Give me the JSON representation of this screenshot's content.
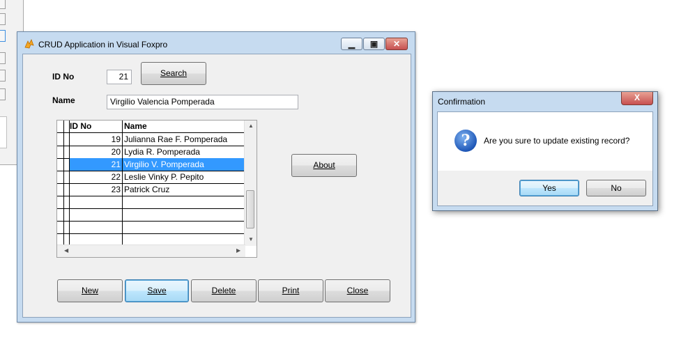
{
  "main_window": {
    "title": "CRUD Application in Visual Foxpro",
    "controls": {
      "minimize": "▁",
      "restore": "▣",
      "close": "✕"
    }
  },
  "form": {
    "id_label": "ID No",
    "id_value": "21",
    "search_button": "Search",
    "name_label": "Name",
    "name_value": "Virgilio Valencia Pomperada",
    "about_button": "About"
  },
  "grid": {
    "columns": [
      "ID No",
      "Name"
    ],
    "rows": [
      {
        "id": "19",
        "name": "Julianna Rae F. Pomperada"
      },
      {
        "id": "20",
        "name": "Lydia R. Pomperada"
      },
      {
        "id": "21",
        "name": "Virgilio V. Pomperada"
      },
      {
        "id": "22",
        "name": "Leslie Vinky P. Pepito"
      },
      {
        "id": "23",
        "name": "Patrick Cruz"
      }
    ],
    "selected_id": "21"
  },
  "toolbar": {
    "new_label": "New",
    "save_label": "Save",
    "delete_label": "Delete",
    "print_label": "Print",
    "close_label": "Close"
  },
  "dialog": {
    "title": "Confirmation",
    "close_glyph": "X",
    "message": "Are you sure to update existing record?",
    "yes_label": "Yes",
    "no_label": "No",
    "icon": "question-icon"
  },
  "colors": {
    "selection": "#3399ff",
    "window_frame": "#c6dbf0",
    "close_button": "#c75050"
  }
}
